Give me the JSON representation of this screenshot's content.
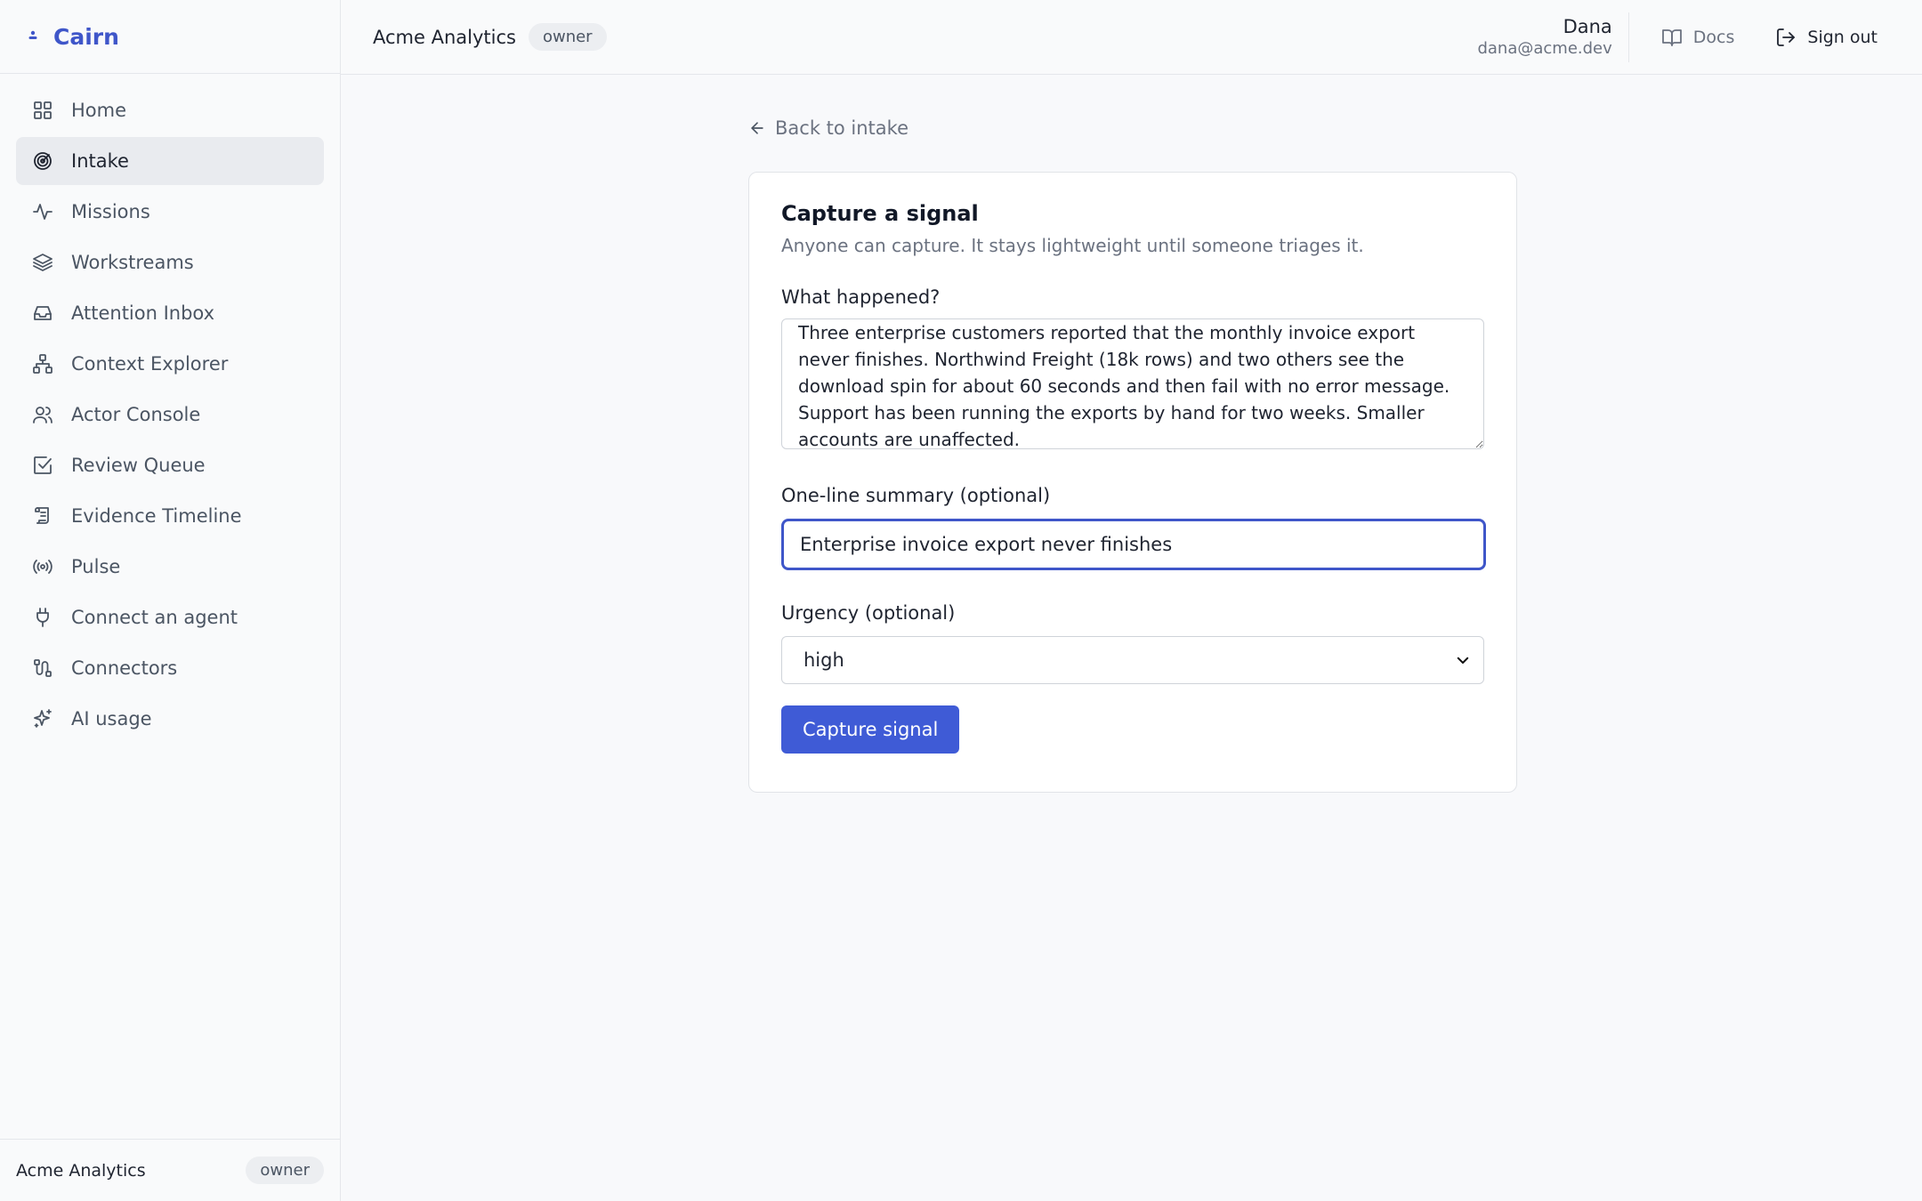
{
  "brand": {
    "name": "Cairn",
    "accent": "#3f56c9"
  },
  "sidebar": {
    "items": [
      {
        "label": "Home",
        "icon": "grid-icon"
      },
      {
        "label": "Intake",
        "icon": "target-icon",
        "active": true
      },
      {
        "label": "Missions",
        "icon": "activity-icon"
      },
      {
        "label": "Workstreams",
        "icon": "layers-icon"
      },
      {
        "label": "Attention Inbox",
        "icon": "inbox-icon"
      },
      {
        "label": "Context Explorer",
        "icon": "network-icon"
      },
      {
        "label": "Actor Console",
        "icon": "users-icon"
      },
      {
        "label": "Review Queue",
        "icon": "check-square-icon"
      },
      {
        "label": "Evidence Timeline",
        "icon": "scroll-icon"
      },
      {
        "label": "Pulse",
        "icon": "radio-icon"
      },
      {
        "label": "Connect an agent",
        "icon": "plug-icon"
      },
      {
        "label": "Connectors",
        "icon": "cable-icon"
      },
      {
        "label": "AI usage",
        "icon": "sparkles-icon"
      }
    ],
    "footer": {
      "org": "Acme Analytics",
      "role": "owner"
    }
  },
  "header": {
    "org": "Acme Analytics",
    "role": "owner",
    "user_name": "Dana",
    "user_email": "dana@acme.dev",
    "docs_label": "Docs",
    "signout_label": "Sign out"
  },
  "page": {
    "back_label": "Back to intake",
    "title": "Capture a signal",
    "subtitle": "Anyone can capture. It stays lightweight until someone triages it.",
    "what_label": "What happened?",
    "what_value": "Three enterprise customers reported that the monthly invoice export never finishes. Northwind Freight (18k rows) and two others see the download spin for about 60 seconds and then fail with no error message. Support has been running the exports by hand for two weeks. Smaller accounts are unaffected.",
    "summary_label": "One-line summary (optional)",
    "summary_value": "Enterprise invoice export never finishes",
    "urgency_label": "Urgency (optional)",
    "urgency_value": "high",
    "submit_label": "Capture signal"
  }
}
